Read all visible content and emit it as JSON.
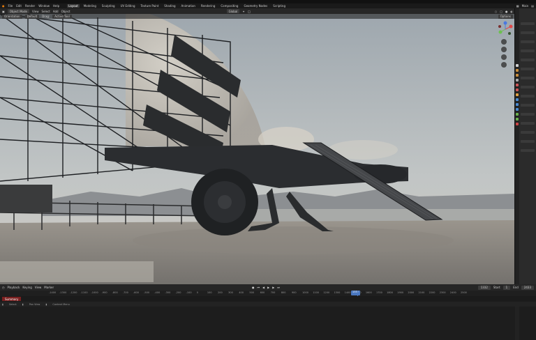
{
  "topbar": {},
  "menubar": {
    "menus": [
      "File",
      "Edit",
      "Render",
      "Window",
      "Help"
    ],
    "workspaces": [
      "Layout",
      "Modeling",
      "Sculpting",
      "UV Editing",
      "Texture Paint",
      "Shading",
      "Animation",
      "Rendering",
      "Compositing",
      "Geometry Nodes",
      "Scripting"
    ],
    "scene": "Main"
  },
  "viewport_header": {
    "mode": "Object Mode",
    "menus": [
      "View",
      "Select",
      "Add",
      "Object"
    ],
    "transform": "Global",
    "options": "Options"
  },
  "tool_header": {
    "orientation": "Orientation",
    "default": "Default",
    "drag": "Drag:",
    "active_tool": "Active Tool"
  },
  "timeline": {
    "menus": [
      "Playback",
      "Keying",
      "View",
      "Marker"
    ],
    "current_frame": "1332",
    "start_label": "Start",
    "start": "1",
    "end_label": "End",
    "end": "2433",
    "summary": "Summary",
    "ticks": [
      "-1400",
      "-1300",
      "-1200",
      "-1100",
      "-1000",
      "-900",
      "-800",
      "-700",
      "-600",
      "-500",
      "-400",
      "-300",
      "-200",
      "-100",
      "0",
      "100",
      "200",
      "300",
      "400",
      "500",
      "600",
      "700",
      "800",
      "900",
      "1000",
      "1100",
      "1200",
      "1300",
      "1400",
      "1500",
      "1600",
      "1700",
      "1800",
      "1900",
      "2000",
      "2100",
      "2200",
      "2300",
      "2400",
      "2500"
    ]
  },
  "status": {
    "left": "Select",
    "mid": "Pan View",
    "right": "Context Menu"
  },
  "colors": {
    "accent": "#4a78c0",
    "summary": "#7a2020",
    "sky": "#b4bcc2",
    "ground": "#8a8884"
  }
}
